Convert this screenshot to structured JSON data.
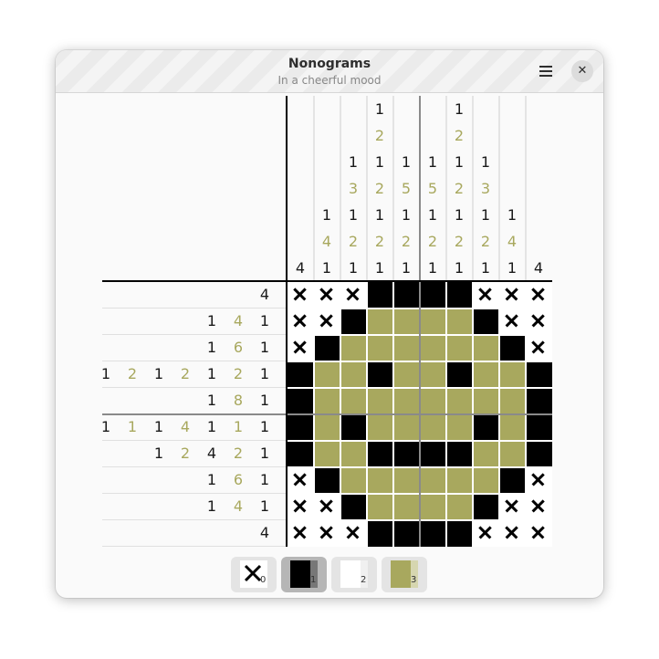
{
  "window": {
    "title": "Nonograms",
    "subtitle": "In a cheerful mood",
    "menu_icon": "hamburger-icon",
    "close_label": "✕"
  },
  "colors": {
    "black": "#000000",
    "olive": "#a8a85e",
    "empty": "#ffffff"
  },
  "puzzle": {
    "size": 10,
    "column_clues": [
      [
        {
          "n": "4",
          "c": "k"
        }
      ],
      [
        {
          "n": "1",
          "c": "k"
        },
        {
          "n": "4",
          "c": "o"
        },
        {
          "n": "1",
          "c": "k"
        }
      ],
      [
        {
          "n": "1",
          "c": "k"
        },
        {
          "n": "3",
          "c": "o"
        },
        {
          "n": "1",
          "c": "k"
        },
        {
          "n": "2",
          "c": "o"
        },
        {
          "n": "1",
          "c": "k"
        }
      ],
      [
        {
          "n": "1",
          "c": "k"
        },
        {
          "n": "2",
          "c": "o"
        },
        {
          "n": "1",
          "c": "k"
        },
        {
          "n": "2",
          "c": "o"
        },
        {
          "n": "1",
          "c": "k"
        },
        {
          "n": "2",
          "c": "o"
        },
        {
          "n": "1",
          "c": "k"
        }
      ],
      [
        {
          "n": "1",
          "c": "k"
        },
        {
          "n": "5",
          "c": "o"
        },
        {
          "n": "1",
          "c": "k"
        },
        {
          "n": "2",
          "c": "o"
        },
        {
          "n": "1",
          "c": "k"
        }
      ],
      [
        {
          "n": "1",
          "c": "k"
        },
        {
          "n": "5",
          "c": "o"
        },
        {
          "n": "1",
          "c": "k"
        },
        {
          "n": "2",
          "c": "o"
        },
        {
          "n": "1",
          "c": "k"
        }
      ],
      [
        {
          "n": "1",
          "c": "k"
        },
        {
          "n": "2",
          "c": "o"
        },
        {
          "n": "1",
          "c": "k"
        },
        {
          "n": "2",
          "c": "o"
        },
        {
          "n": "1",
          "c": "k"
        },
        {
          "n": "2",
          "c": "o"
        },
        {
          "n": "1",
          "c": "k"
        }
      ],
      [
        {
          "n": "1",
          "c": "k"
        },
        {
          "n": "3",
          "c": "o"
        },
        {
          "n": "1",
          "c": "k"
        },
        {
          "n": "2",
          "c": "o"
        },
        {
          "n": "1",
          "c": "k"
        }
      ],
      [
        {
          "n": "1",
          "c": "k"
        },
        {
          "n": "4",
          "c": "o"
        },
        {
          "n": "1",
          "c": "k"
        }
      ],
      [
        {
          "n": "4",
          "c": "k"
        }
      ]
    ],
    "row_clues": [
      [
        {
          "n": "4",
          "c": "k"
        }
      ],
      [
        {
          "n": "1",
          "c": "k"
        },
        {
          "n": "4",
          "c": "o"
        },
        {
          "n": "1",
          "c": "k"
        }
      ],
      [
        {
          "n": "1",
          "c": "k"
        },
        {
          "n": "6",
          "c": "o"
        },
        {
          "n": "1",
          "c": "k"
        }
      ],
      [
        {
          "n": "1",
          "c": "k"
        },
        {
          "n": "2",
          "c": "o"
        },
        {
          "n": "1",
          "c": "k"
        },
        {
          "n": "2",
          "c": "o"
        },
        {
          "n": "1",
          "c": "k"
        },
        {
          "n": "2",
          "c": "o"
        },
        {
          "n": "1",
          "c": "k"
        }
      ],
      [
        {
          "n": "1",
          "c": "k"
        },
        {
          "n": "8",
          "c": "o"
        },
        {
          "n": "1",
          "c": "k"
        }
      ],
      [
        {
          "n": "1",
          "c": "k"
        },
        {
          "n": "1",
          "c": "o"
        },
        {
          "n": "1",
          "c": "k"
        },
        {
          "n": "4",
          "c": "o"
        },
        {
          "n": "1",
          "c": "k"
        },
        {
          "n": "1",
          "c": "o"
        },
        {
          "n": "1",
          "c": "k"
        }
      ],
      [
        {
          "n": "1",
          "c": "k"
        },
        {
          "n": "2",
          "c": "o"
        },
        {
          "n": "4",
          "c": "k"
        },
        {
          "n": "2",
          "c": "o"
        },
        {
          "n": "1",
          "c": "k"
        }
      ],
      [
        {
          "n": "1",
          "c": "k"
        },
        {
          "n": "6",
          "c": "o"
        },
        {
          "n": "1",
          "c": "k"
        }
      ],
      [
        {
          "n": "1",
          "c": "k"
        },
        {
          "n": "4",
          "c": "o"
        },
        {
          "n": "1",
          "c": "k"
        }
      ],
      [
        {
          "n": "4",
          "c": "k"
        }
      ]
    ],
    "grid": [
      "XXXBBBBXXX",
      "XXBGGGGBXX",
      "XBGGGGGGBX",
      "BGGBGGBGGB",
      "BGGGGGGGGB",
      "BGBGGGGBGB",
      "BGGBBBBGGB",
      "XBGGGGGGBX",
      "XXBGGGGBXX",
      "XXXBBBBXXX"
    ]
  },
  "palette": [
    {
      "index": "0",
      "name": "cross",
      "selected": false
    },
    {
      "index": "1",
      "name": "black",
      "selected": true
    },
    {
      "index": "2",
      "name": "white",
      "selected": false
    },
    {
      "index": "3",
      "name": "olive",
      "selected": false
    }
  ]
}
